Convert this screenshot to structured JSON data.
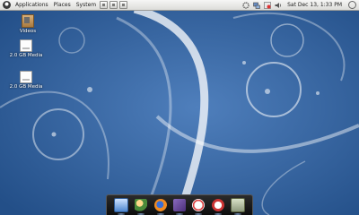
{
  "top_panel": {
    "menus": [
      "Applications",
      "Places",
      "System"
    ],
    "clock": "Sat Dec 13,  1:33 PM"
  },
  "desktop_icons": [
    {
      "label": "Videos",
      "icon": "folder-videos-icon"
    },
    {
      "label": "2.0 GB Media",
      "icon": "removable-drive-icon"
    },
    {
      "label": "2.0 GB Media",
      "icon": "removable-drive-icon"
    }
  ],
  "dock_items": [
    "computer-icon",
    "users-icon",
    "firefox-icon",
    "installer-icon",
    "help-icon",
    "opera-icon",
    "calculator-icon"
  ],
  "colors": {
    "wallpaper": "#2f5f9a",
    "panel": "#e8e8e6"
  }
}
